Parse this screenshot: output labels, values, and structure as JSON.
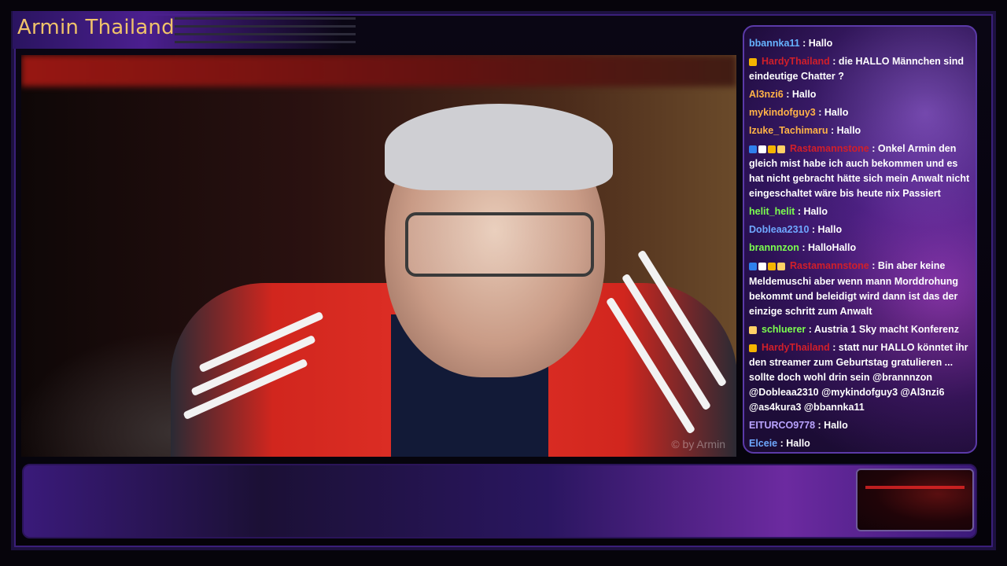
{
  "header": {
    "title": "Armin Thailand"
  },
  "video": {
    "watermark": "© by Armin"
  },
  "chat": {
    "messages": [
      {
        "user": "bbannka11",
        "user_color": "#66b3ff",
        "text": ": Hallo",
        "badges": []
      },
      {
        "user": "HardyThailand",
        "user_color": "#d11f2a",
        "text": ": die HALLO Männchen sind eindeutige Chatter ?",
        "badges": [
          "coin-badge-icon"
        ]
      },
      {
        "user": "Al3nzi6",
        "user_color": "#ffb347",
        "text": ": Hallo",
        "badges": []
      },
      {
        "user": "mykindofguy3",
        "user_color": "#ffb347",
        "text": ": Hallo",
        "badges": []
      },
      {
        "user": "Izuke_Tachimaru",
        "user_color": "#ffb347",
        "text": ": Hallo",
        "badges": []
      },
      {
        "user": "Rastamannstone",
        "user_color": "#d11f2a",
        "text": ": Onkel Armin den gleich mist habe ich auch bekommen und es hat nicht gebracht hätte sich mein Anwalt nicht eingeschaltet wäre bis heute nix Passiert",
        "badges": [
          "turbo-badge-icon",
          "flag-badge-icon",
          "coin-badge-icon",
          "crown-badge-icon"
        ]
      },
      {
        "user": "helit_helit",
        "user_color": "#7cff4f",
        "text": ": Hallo",
        "badges": []
      },
      {
        "user": "Dobleaa2310",
        "user_color": "#6fa8ff",
        "text": ": Hallo",
        "badges": []
      },
      {
        "user": "brannnzon",
        "user_color": "#7cff4f",
        "text": ": HalloHallo",
        "badges": []
      },
      {
        "user": "Rastamannstone",
        "user_color": "#d11f2a",
        "text": ": Bin aber keine Meldemuschi aber wenn mann Morddrohung bekommt und beleidigt wird dann ist das der einzige schritt zum Anwalt",
        "badges": [
          "turbo-badge-icon",
          "flag-badge-icon",
          "coin-badge-icon",
          "crown-badge-icon"
        ]
      },
      {
        "user": "schluerer",
        "user_color": "#7cff4f",
        "text": ": Austria 1 Sky macht Konferenz",
        "badges": [
          "crown-badge-icon"
        ]
      },
      {
        "user": "HardyThailand",
        "user_color": "#d11f2a",
        "text": ": statt nur HALLO könntet ihr den streamer zum Geburtstag gratulieren ... sollte doch wohl drin sein @brannnzon @Dobleaa2310 @mykindofguy3 @Al3nzi6 @as4kura3 @bbannka11",
        "badges": [
          "coin-badge-icon"
        ]
      },
      {
        "user": "EITURCO9778",
        "user_color": "#b9a3ff",
        "text": ": Hallo",
        "badges": []
      },
      {
        "user": "Elceie",
        "user_color": "#6fa8ff",
        "text": ": Hallo",
        "badges": []
      }
    ]
  }
}
